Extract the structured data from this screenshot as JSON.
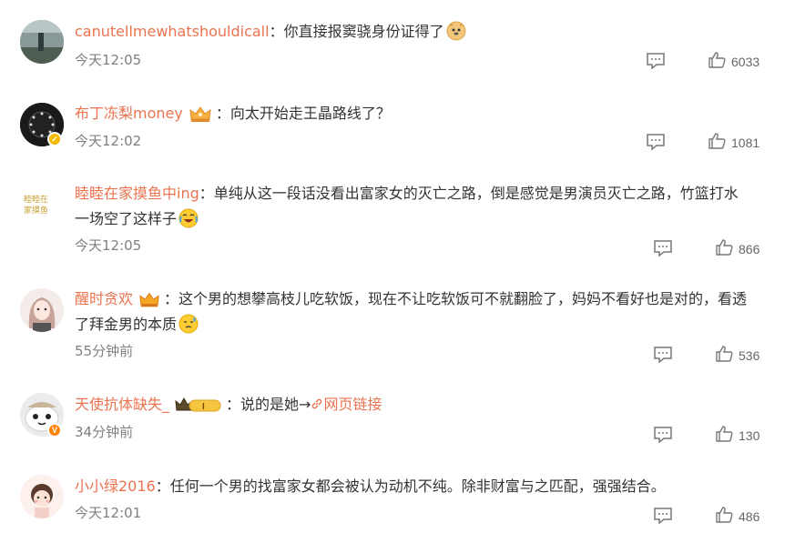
{
  "colors": {
    "username": "#eb7350",
    "text": "#333333",
    "meta": "#808080"
  },
  "comments": [
    {
      "username": "canutellmewhatshouldicall",
      "sep": "：",
      "text": "你直接报窦骁身份证得了",
      "emoji": "doge-emoji",
      "time": "今天12:05",
      "likes": "6033"
    },
    {
      "username": "布丁冻梨money",
      "sep": "：",
      "text": "向太开始走王晶路线了？",
      "time": "今天12:02",
      "likes": "1081"
    },
    {
      "username": "睦睦在家摸鱼中ing",
      "sep": "：",
      "text": "单纯从这一段话没看出富家女的灭亡之路，倒是感觉是男演员灭亡之路，竹篮打水",
      "text2": "一场空了这样子",
      "emoji": "laugh-cry-emoji",
      "time": "今天12:05",
      "likes": "866"
    },
    {
      "username": "醒时贪欢",
      "sep": "：",
      "text": "这个男的想攀高枝儿吃软饭，现在不让吃软饭可不就翻脸了，妈妈不看好也是对的，看透",
      "text2": "了拜金男的本质",
      "emoji": "sweat-emoji",
      "time": "55分钟前",
      "likes": "536"
    },
    {
      "username": "天使抗体缺失_",
      "sep": "：",
      "text": "说的是她→",
      "link": "网页链接",
      "time": "34分钟前",
      "likes": "130"
    },
    {
      "username": "小小绿2016",
      "sep": "：",
      "text": "任何一个男的找富家女都会被认为动机不纯。除非财富与之匹配，强强结合。",
      "time": "今天12:01",
      "likes": "486"
    }
  ]
}
